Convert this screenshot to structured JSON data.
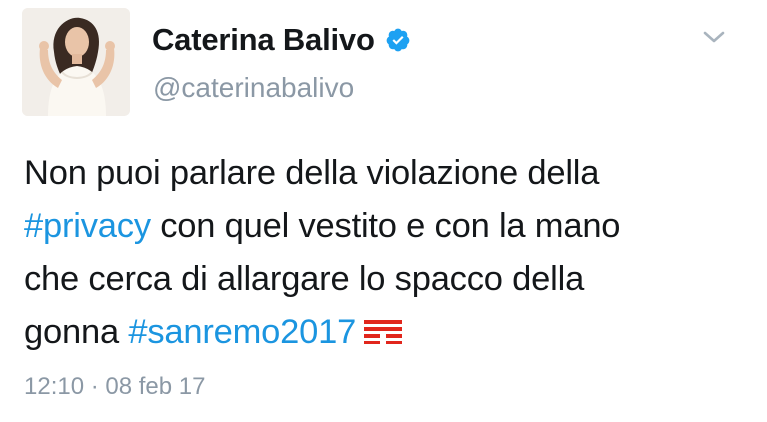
{
  "tweet": {
    "author": {
      "display_name": "Caterina Balivo",
      "handle": "@caterinabalivo",
      "verified_icon": "verified-badge-icon",
      "avatar": "profile-photo"
    },
    "menu_icon": "chevron-down-icon",
    "text_lines": [
      {
        "parts": [
          {
            "text": "Non puoi parlare della violazione della",
            "type": "text"
          }
        ]
      },
      {
        "parts": [
          {
            "text": "#privacy",
            "type": "hashtag"
          },
          {
            "text": " con quel vestito e con la mano",
            "type": "text"
          }
        ]
      },
      {
        "parts": [
          {
            "text": "che cerca di allargare lo spacco della",
            "type": "text"
          }
        ]
      },
      {
        "parts": [
          {
            "text": "gonna ",
            "type": "text"
          },
          {
            "text": "#sanremo2017",
            "type": "hashtag"
          }
        ]
      }
    ],
    "hashflag_icon": "tim-logo-icon",
    "timestamp": "12:10 · 08 feb 17",
    "colors": {
      "hashtag": "#1b95e0",
      "verified": "#1da1f2",
      "muted": "#8b98a5",
      "text": "#14171a",
      "hashflag": "#e1261c"
    }
  }
}
